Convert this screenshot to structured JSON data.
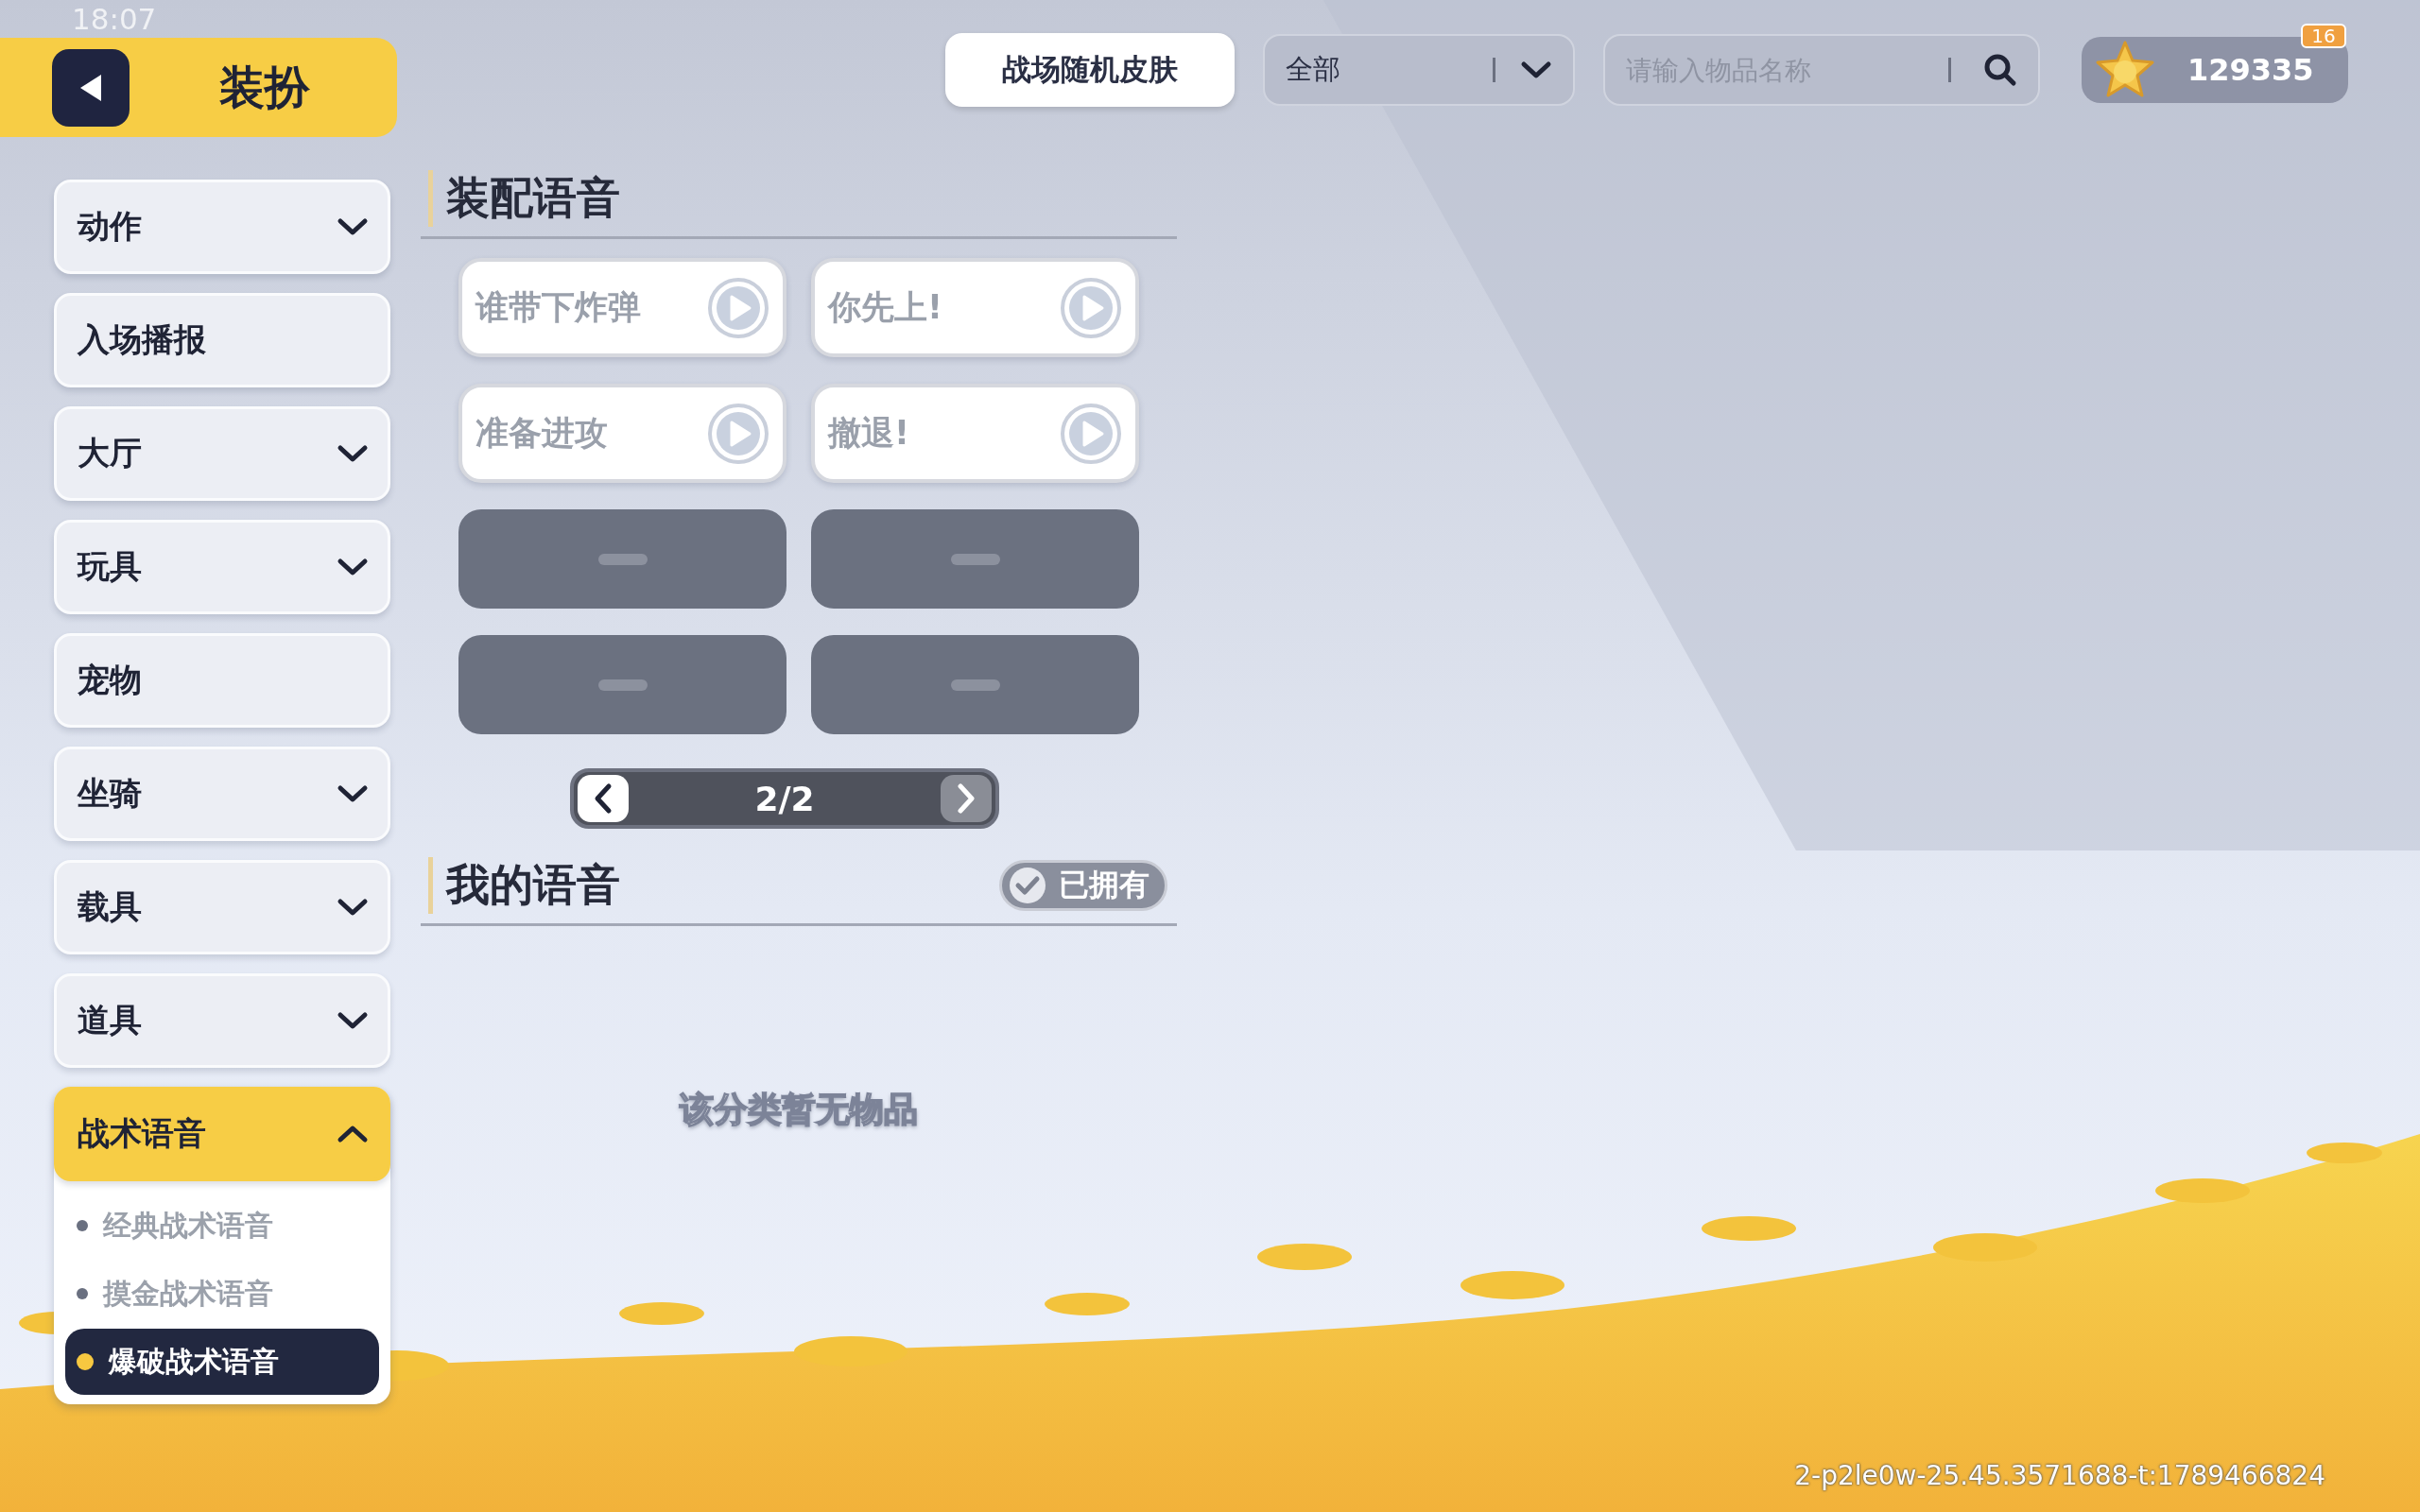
{
  "status_bar": {
    "time": "18:07",
    "battery": "16"
  },
  "header": {
    "title": "装扮"
  },
  "toolbar": {
    "random_skin_button": "战场随机皮肤",
    "filter": {
      "value": "全部"
    },
    "search": {
      "placeholder": "请输入物品名称"
    },
    "coins": "129335"
  },
  "sidebar": {
    "items": [
      {
        "label": "动作",
        "kind": "group",
        "expanded": false,
        "selected": false
      },
      {
        "label": "入场播报",
        "kind": "plain",
        "selected": false
      },
      {
        "label": "大厅",
        "kind": "group",
        "expanded": false,
        "selected": false
      },
      {
        "label": "玩具",
        "kind": "group",
        "expanded": false,
        "selected": false
      },
      {
        "label": "宠物",
        "kind": "plain",
        "selected": false
      },
      {
        "label": "坐骑",
        "kind": "group",
        "expanded": false,
        "selected": false
      },
      {
        "label": "载具",
        "kind": "group",
        "expanded": false,
        "selected": false
      },
      {
        "label": "道具",
        "kind": "group",
        "expanded": false,
        "selected": false
      },
      {
        "label": "战术语音",
        "kind": "group",
        "expanded": true,
        "selected": true,
        "children": [
          {
            "label": "经典战术语音",
            "selected": false
          },
          {
            "label": "摸金战术语音",
            "selected": false
          },
          {
            "label": "爆破战术语音",
            "selected": true
          }
        ]
      }
    ]
  },
  "equipped": {
    "title": "装配语音",
    "slots": [
      {
        "kind": "voice",
        "label": "谁带下炸弹"
      },
      {
        "kind": "voice",
        "label": "你先上!"
      },
      {
        "kind": "voice",
        "label": "准备进攻"
      },
      {
        "kind": "voice",
        "label": "撤退!"
      },
      {
        "kind": "empty"
      },
      {
        "kind": "empty"
      },
      {
        "kind": "empty"
      },
      {
        "kind": "empty"
      }
    ],
    "pager": {
      "label": "2/2",
      "prev_disabled": false,
      "next_disabled": true
    }
  },
  "my_voices": {
    "title": "我的语音",
    "owned_filter": {
      "label": "已拥有",
      "checked": true
    },
    "empty_message": "该分类暂无物品"
  },
  "build_info": "2-p2le0w-25.45.3571688-t:1789466824"
}
